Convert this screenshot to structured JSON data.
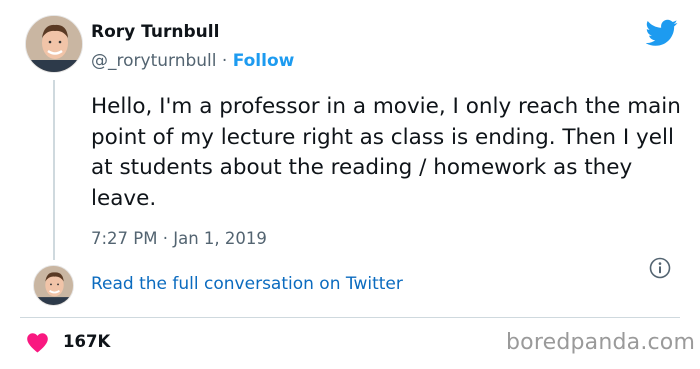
{
  "author": {
    "display_name": "Rory Turnbull",
    "handle": "@_roryturnbull",
    "separator": "·",
    "follow_label": "Follow"
  },
  "tweet": {
    "text": "Hello, I'm a professor in a movie, I only reach the main point of my lecture right as class is ending. Then I yell at students about the reading / homework as they leave.",
    "timestamp": "7:27 PM · Jan 1, 2019"
  },
  "thread": {
    "read_full_label": "Read the full conversation on Twitter"
  },
  "stats": {
    "likes": "167K"
  },
  "watermark": "boredpanda.com",
  "icons": {
    "brand": "twitter-bird-icon",
    "info": "info-icon",
    "like": "heart-icon"
  },
  "colors": {
    "twitter_blue": "#1d9bf0",
    "link_blue": "#0b6bbf",
    "heart_pink": "#f91880",
    "secondary_text": "#536471"
  }
}
